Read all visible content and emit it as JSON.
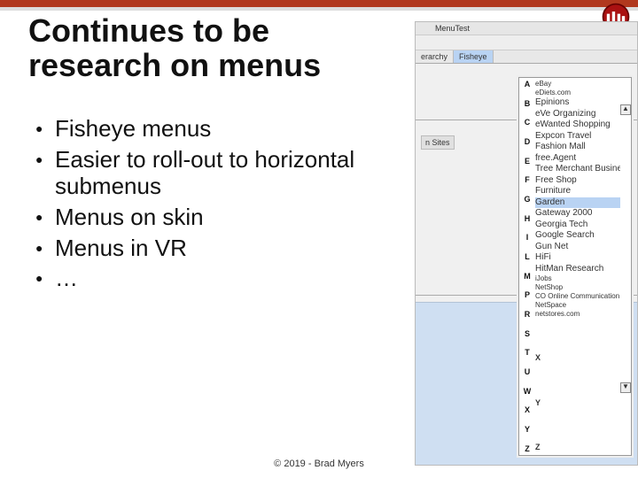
{
  "title_line1": "Continues to be",
  "title_line2": "research on menus",
  "bullets": {
    "b1": "Fisheye menus",
    "b2": "Easier to roll-out to horizontal submenus",
    "b3": "Menus on skin",
    "b4": "Menus in VR",
    "b5": "…"
  },
  "footer": "© 2019 - Brad Myers",
  "shot": {
    "window_title": "MenuTest",
    "tabs": {
      "t1": "erarchy",
      "t2": "Fisheye"
    },
    "side_label": "n Sites",
    "fisheye_letters": [
      "A",
      "B",
      "C",
      "D",
      "E",
      "F",
      "G",
      "H",
      "I",
      "L",
      "M",
      "P",
      "R",
      "S",
      "T",
      "U",
      "W",
      "X",
      "Y",
      "Z"
    ],
    "fisheye_items": [
      "eBay",
      "eDiets.com",
      "Epinions",
      "eVe Organizing",
      "eWanted Shopping",
      "Expcon Travel",
      "Fashion Mall",
      "free.Agent",
      "Tree Merchant Business",
      "Free Shop",
      "Furniture",
      "Garden",
      "Gateway 2000",
      "Georgia Tech",
      "Google Search",
      "Gun Net",
      "HiFi",
      "HitMan Research",
      "iJobs",
      "NetShop",
      "CO Online Communication",
      "NetSpace",
      "netstores.com"
    ],
    "selected_item": "Garden",
    "scroll_up": "▲",
    "scroll_dn": "▼"
  }
}
